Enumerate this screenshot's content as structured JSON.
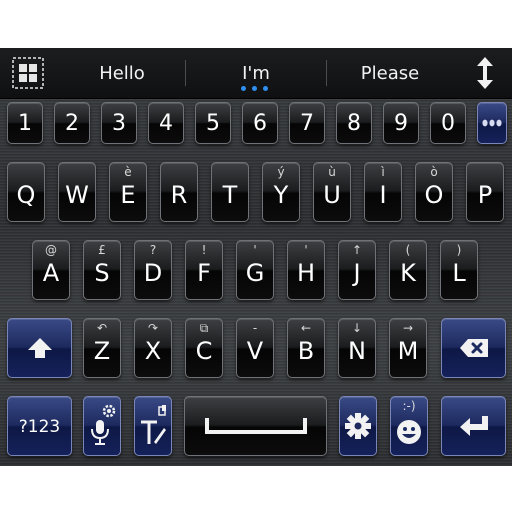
{
  "suggestions": [
    "Hello",
    "I'm",
    "Please"
  ],
  "icons": {
    "menu": "grid-menu-icon",
    "resize": "vertical-resize-icon",
    "more": "more-dots-icon",
    "shift": "shift-arrow-icon",
    "backspace": "backspace-icon",
    "mic": "microphone-settings-icon",
    "text": "text-style-icon",
    "space": "space-bar-icon",
    "settings": "gear-icon",
    "emoji": "smiley-emoji-icon",
    "enter": "enter-return-icon"
  },
  "colors": {
    "suggestion_dot": "#2f8ff0",
    "key_dark": "#0c0c0d",
    "key_blue": "#1d2a5f"
  },
  "rows": {
    "numbers": [
      "1",
      "2",
      "3",
      "4",
      "5",
      "6",
      "7",
      "8",
      "9",
      "0"
    ],
    "row1": [
      {
        "label": "Q",
        "alt": ""
      },
      {
        "label": "W",
        "alt": ""
      },
      {
        "label": "E",
        "alt": "è"
      },
      {
        "label": "R",
        "alt": ""
      },
      {
        "label": "T",
        "alt": ""
      },
      {
        "label": "Y",
        "alt": "ý"
      },
      {
        "label": "U",
        "alt": "ù"
      },
      {
        "label": "I",
        "alt": "ì"
      },
      {
        "label": "O",
        "alt": "ò"
      },
      {
        "label": "P",
        "alt": ""
      }
    ],
    "row2": [
      {
        "label": "A",
        "alt": "@"
      },
      {
        "label": "S",
        "alt": "£"
      },
      {
        "label": "D",
        "alt": "?"
      },
      {
        "label": "F",
        "alt": "!"
      },
      {
        "label": "G",
        "alt": "'"
      },
      {
        "label": "H",
        "alt": "'"
      },
      {
        "label": "J",
        "alt": "↑"
      },
      {
        "label": "K",
        "alt": "("
      },
      {
        "label": "L",
        "alt": ")"
      }
    ],
    "row3": [
      {
        "label": "Z",
        "alt": "↶"
      },
      {
        "label": "X",
        "alt": "↷"
      },
      {
        "label": "C",
        "alt": "⧉"
      },
      {
        "label": "V",
        "alt": "-"
      },
      {
        "label": "B",
        "alt": "←"
      },
      {
        "label": "N",
        "alt": "↓"
      },
      {
        "label": "M",
        "alt": "→"
      }
    ]
  },
  "bottom": {
    "symbols_label": "?123",
    "emoji_alt": ":-)"
  }
}
